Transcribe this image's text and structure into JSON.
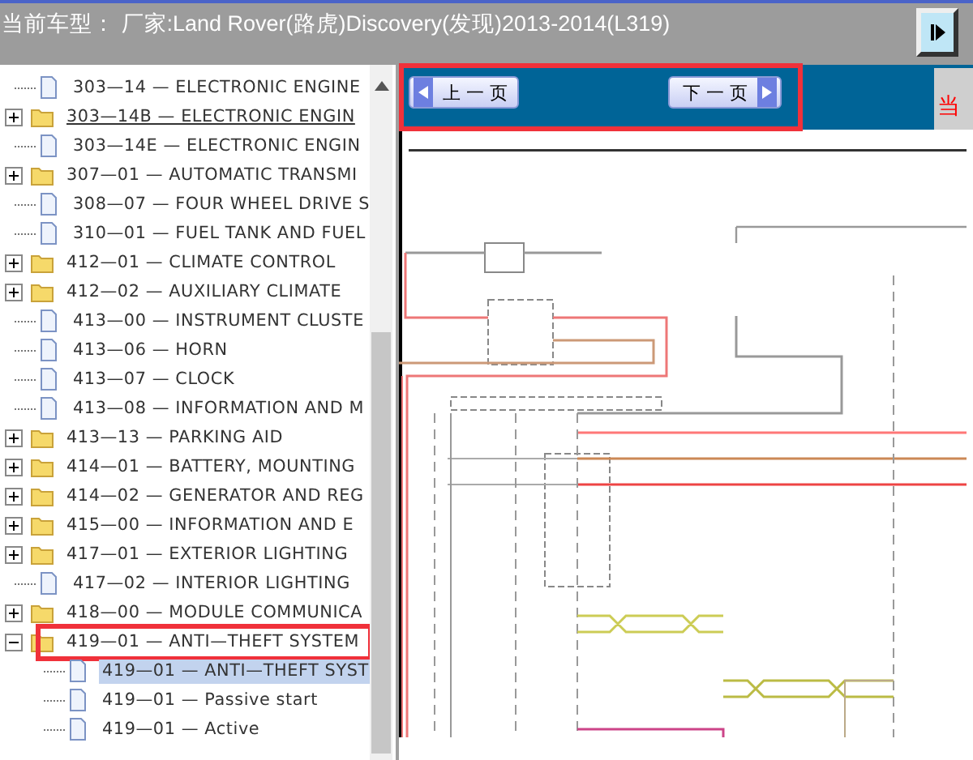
{
  "header": {
    "title": "当前车型： 厂家:Land Rover(路虎)Discovery(发现)2013-2014(L319)"
  },
  "tree": {
    "items": [
      {
        "label": "303—14 — ELECTRONIC ENGINE",
        "kind": "page",
        "selected": false,
        "hovered": false,
        "highlighted": false
      },
      {
        "label": "303—14B — ELECTRONIC ENGIN",
        "kind": "folder",
        "expanded": false,
        "selected": false,
        "hovered": true,
        "highlighted": false
      },
      {
        "label": "303—14E — ELECTRONIC ENGIN",
        "kind": "page",
        "selected": false,
        "hovered": false,
        "highlighted": false
      },
      {
        "label": "307—01 — AUTOMATIC TRANSMI",
        "kind": "folder",
        "expanded": false,
        "selected": false,
        "hovered": false,
        "highlighted": false
      },
      {
        "label": "308—07 — FOUR WHEEL DRIVE S",
        "kind": "page",
        "selected": false,
        "hovered": false,
        "highlighted": false
      },
      {
        "label": "310—01 — FUEL TANK AND FUEL",
        "kind": "page",
        "selected": false,
        "hovered": false,
        "highlighted": false
      },
      {
        "label": "412—01 — CLIMATE CONTROL",
        "kind": "folder",
        "expanded": false,
        "selected": false,
        "hovered": false,
        "highlighted": false
      },
      {
        "label": "412—02 — AUXILIARY CLIMATE",
        "kind": "folder",
        "expanded": false,
        "selected": false,
        "hovered": false,
        "highlighted": false
      },
      {
        "label": "413—00 — INSTRUMENT CLUSTE",
        "kind": "page",
        "selected": false,
        "hovered": false,
        "highlighted": false
      },
      {
        "label": "413—06 — HORN",
        "kind": "page",
        "selected": false,
        "hovered": false,
        "highlighted": false
      },
      {
        "label": "413—07 — CLOCK",
        "kind": "page",
        "selected": false,
        "hovered": false,
        "highlighted": false
      },
      {
        "label": "413—08 — INFORMATION AND M",
        "kind": "page",
        "selected": false,
        "hovered": false,
        "highlighted": false
      },
      {
        "label": "413—13 — PARKING AID",
        "kind": "folder",
        "expanded": false,
        "selected": false,
        "hovered": false,
        "highlighted": false
      },
      {
        "label": "414—01 — BATTERY, MOUNTING",
        "kind": "folder",
        "expanded": false,
        "selected": false,
        "hovered": false,
        "highlighted": false
      },
      {
        "label": "414—02 — GENERATOR AND REG",
        "kind": "folder",
        "expanded": false,
        "selected": false,
        "hovered": false,
        "highlighted": false
      },
      {
        "label": "415—00 — INFORMATION AND E",
        "kind": "folder",
        "expanded": false,
        "selected": false,
        "hovered": false,
        "highlighted": false
      },
      {
        "label": "417—01 — EXTERIOR LIGHTING",
        "kind": "folder",
        "expanded": false,
        "selected": false,
        "hovered": false,
        "highlighted": false
      },
      {
        "label": "417—02 — INTERIOR LIGHTING",
        "kind": "page",
        "selected": false,
        "hovered": false,
        "highlighted": false
      },
      {
        "label": "418—00 — MODULE COMMUNICA",
        "kind": "folder",
        "expanded": false,
        "selected": false,
        "hovered": false,
        "highlighted": false
      },
      {
        "label": "419—01 — ANTI—THEFT SYSTEM",
        "kind": "folder",
        "expanded": true,
        "selected": false,
        "hovered": false,
        "highlighted": true,
        "children": [
          {
            "label": "419—01 — ANTI—THEFT SYST",
            "kind": "page",
            "selected": true,
            "hovered": false,
            "highlighted": false
          },
          {
            "label": "419—01 — Passive start",
            "kind": "page",
            "selected": false,
            "hovered": false,
            "highlighted": false
          },
          {
            "label": "419—01 — Active",
            "kind": "page",
            "selected": false,
            "hovered": false,
            "highlighted": false
          }
        ]
      }
    ]
  },
  "toolbar": {
    "highlighted": true,
    "buttons": [
      {
        "label": "上 一 页",
        "kind": "prev"
      },
      {
        "label": "下 一 页",
        "kind": "next"
      }
    ],
    "status_text": "当"
  }
}
